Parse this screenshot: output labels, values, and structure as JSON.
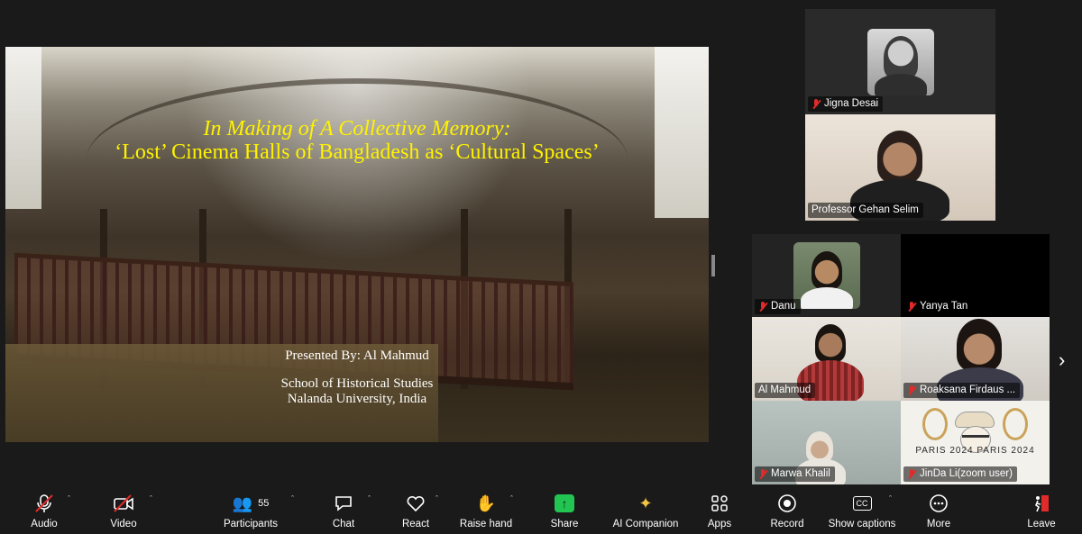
{
  "slide": {
    "title_line1": "In Making of A Collective Memory:",
    "title_line2": "‘Lost’ Cinema Halls of Bangladesh as ‘Cultural Spaces’",
    "presenter": "Presented By: Al Mahmud",
    "school": "School of  Historical Studies",
    "university": "Nalanda University, India"
  },
  "participants_tiles": [
    {
      "name": "Jigna Desai",
      "muted": true
    },
    {
      "name": "Professor Gehan Selim",
      "muted": false
    },
    {
      "name": "Danu",
      "muted": true
    },
    {
      "name": "Yanya Tan",
      "muted": true
    },
    {
      "name": "Al Mahmud",
      "muted": false
    },
    {
      "name": "Roaksana Firdaus ...",
      "muted": true
    },
    {
      "name": "Marwa Khalil",
      "muted": true
    },
    {
      "name": "JinDa Li(zoom user)",
      "muted": true
    }
  ],
  "paris_logo_text": "PARIS 2024 PARIS 2024",
  "toolbar": {
    "audio": "Audio",
    "video": "Video",
    "participants": "Participants",
    "participants_count": "55",
    "chat": "Chat",
    "react": "React",
    "raise_hand": "Raise hand",
    "share": "Share",
    "ai_companion": "AI Companion",
    "apps": "Apps",
    "record": "Record",
    "show_captions": "Show captions",
    "more": "More",
    "leave": "Leave"
  },
  "colors": {
    "slide_title": "#fff200",
    "share_green": "#23c552",
    "leave_red": "#e02b2b",
    "mute_red": "#e02b2b"
  }
}
